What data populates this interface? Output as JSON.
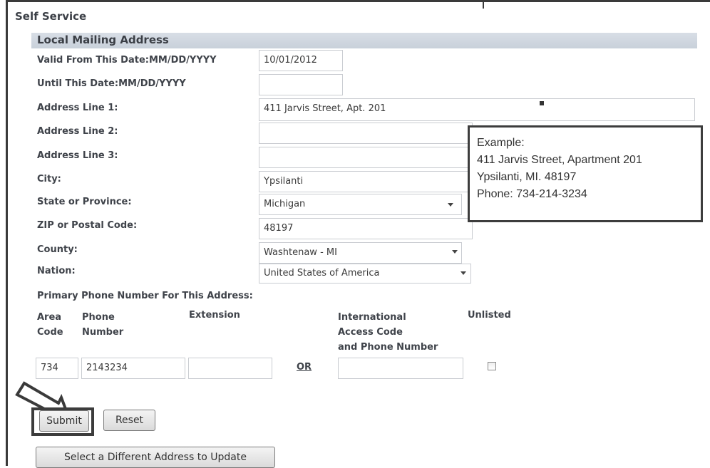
{
  "page": {
    "title": "Self Service",
    "section_title": "Local Mailing Address"
  },
  "form": {
    "valid_from": {
      "label": "Valid From This Date:MM/DD/YYYY",
      "value": "10/01/2012"
    },
    "until": {
      "label": "Until This Date:MM/DD/YYYY",
      "value": ""
    },
    "address1": {
      "label": "Address Line 1:",
      "value": "411 Jarvis Street, Apt. 201"
    },
    "address2": {
      "label": "Address Line 2:",
      "value": ""
    },
    "address3": {
      "label": "Address Line 3:",
      "value": ""
    },
    "city": {
      "label": "City:",
      "value": "Ypsilanti"
    },
    "state": {
      "label": "State or Province:",
      "value": "Michigan"
    },
    "zip": {
      "label": "ZIP or Postal Code:",
      "value": "48197"
    },
    "county": {
      "label": "County:",
      "value": "Washtenaw - MI"
    },
    "nation": {
      "label": "Nation:",
      "value": "United States of America"
    }
  },
  "phone": {
    "heading": "Primary Phone Number For This Address:",
    "col_area_1": "Area",
    "col_area_2": "Code",
    "col_phone_1": "Phone",
    "col_phone_2": "Number",
    "col_extension": "Extension",
    "col_intl_1": "International",
    "col_intl_2": "Access Code",
    "col_intl_3": "and Phone Number",
    "col_unlisted": "Unlisted",
    "area_value": "734",
    "phone_value": "2143234",
    "extension_value": "",
    "or_label": "OR",
    "intl_value": "",
    "unlisted_checked": false
  },
  "example": {
    "line1": "Example:",
    "line2": "411 Jarvis Street,  Apartment 201",
    "line3": "Ypsilanti, MI. 48197",
    "line4": "Phone: 734-214-3234"
  },
  "buttons": {
    "submit": "Submit",
    "reset": "Reset",
    "select_different": "Select a Different Address to Update"
  },
  "icons": {
    "arrow": "arrow-pointer-icon",
    "select_chevron": "chevron-down-icon"
  }
}
